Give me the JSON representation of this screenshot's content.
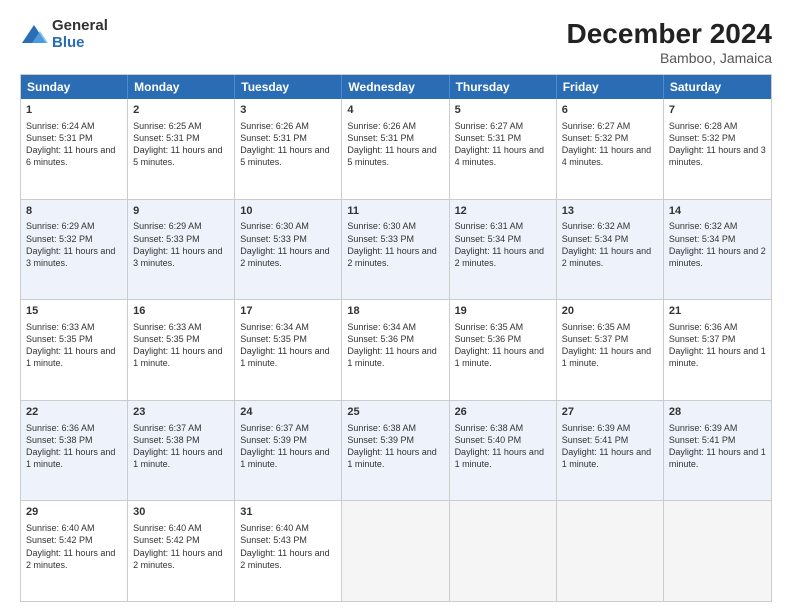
{
  "logo": {
    "general": "General",
    "blue": "Blue"
  },
  "title": {
    "month": "December 2024",
    "location": "Bamboo, Jamaica"
  },
  "header": {
    "days": [
      "Sunday",
      "Monday",
      "Tuesday",
      "Wednesday",
      "Thursday",
      "Friday",
      "Saturday"
    ]
  },
  "weeks": [
    [
      {
        "day": "1",
        "sunrise": "6:24 AM",
        "sunset": "5:31 PM",
        "daylight": "11 hours and 6 minutes."
      },
      {
        "day": "2",
        "sunrise": "6:25 AM",
        "sunset": "5:31 PM",
        "daylight": "11 hours and 5 minutes."
      },
      {
        "day": "3",
        "sunrise": "6:26 AM",
        "sunset": "5:31 PM",
        "daylight": "11 hours and 5 minutes."
      },
      {
        "day": "4",
        "sunrise": "6:26 AM",
        "sunset": "5:31 PM",
        "daylight": "11 hours and 5 minutes."
      },
      {
        "day": "5",
        "sunrise": "6:27 AM",
        "sunset": "5:31 PM",
        "daylight": "11 hours and 4 minutes."
      },
      {
        "day": "6",
        "sunrise": "6:27 AM",
        "sunset": "5:32 PM",
        "daylight": "11 hours and 4 minutes."
      },
      {
        "day": "7",
        "sunrise": "6:28 AM",
        "sunset": "5:32 PM",
        "daylight": "11 hours and 3 minutes."
      }
    ],
    [
      {
        "day": "8",
        "sunrise": "6:29 AM",
        "sunset": "5:32 PM",
        "daylight": "11 hours and 3 minutes."
      },
      {
        "day": "9",
        "sunrise": "6:29 AM",
        "sunset": "5:33 PM",
        "daylight": "11 hours and 3 minutes."
      },
      {
        "day": "10",
        "sunrise": "6:30 AM",
        "sunset": "5:33 PM",
        "daylight": "11 hours and 2 minutes."
      },
      {
        "day": "11",
        "sunrise": "6:30 AM",
        "sunset": "5:33 PM",
        "daylight": "11 hours and 2 minutes."
      },
      {
        "day": "12",
        "sunrise": "6:31 AM",
        "sunset": "5:34 PM",
        "daylight": "11 hours and 2 minutes."
      },
      {
        "day": "13",
        "sunrise": "6:32 AM",
        "sunset": "5:34 PM",
        "daylight": "11 hours and 2 minutes."
      },
      {
        "day": "14",
        "sunrise": "6:32 AM",
        "sunset": "5:34 PM",
        "daylight": "11 hours and 2 minutes."
      }
    ],
    [
      {
        "day": "15",
        "sunrise": "6:33 AM",
        "sunset": "5:35 PM",
        "daylight": "11 hours and 1 minute."
      },
      {
        "day": "16",
        "sunrise": "6:33 AM",
        "sunset": "5:35 PM",
        "daylight": "11 hours and 1 minute."
      },
      {
        "day": "17",
        "sunrise": "6:34 AM",
        "sunset": "5:35 PM",
        "daylight": "11 hours and 1 minute."
      },
      {
        "day": "18",
        "sunrise": "6:34 AM",
        "sunset": "5:36 PM",
        "daylight": "11 hours and 1 minute."
      },
      {
        "day": "19",
        "sunrise": "6:35 AM",
        "sunset": "5:36 PM",
        "daylight": "11 hours and 1 minute."
      },
      {
        "day": "20",
        "sunrise": "6:35 AM",
        "sunset": "5:37 PM",
        "daylight": "11 hours and 1 minute."
      },
      {
        "day": "21",
        "sunrise": "6:36 AM",
        "sunset": "5:37 PM",
        "daylight": "11 hours and 1 minute."
      }
    ],
    [
      {
        "day": "22",
        "sunrise": "6:36 AM",
        "sunset": "5:38 PM",
        "daylight": "11 hours and 1 minute."
      },
      {
        "day": "23",
        "sunrise": "6:37 AM",
        "sunset": "5:38 PM",
        "daylight": "11 hours and 1 minute."
      },
      {
        "day": "24",
        "sunrise": "6:37 AM",
        "sunset": "5:39 PM",
        "daylight": "11 hours and 1 minute."
      },
      {
        "day": "25",
        "sunrise": "6:38 AM",
        "sunset": "5:39 PM",
        "daylight": "11 hours and 1 minute."
      },
      {
        "day": "26",
        "sunrise": "6:38 AM",
        "sunset": "5:40 PM",
        "daylight": "11 hours and 1 minute."
      },
      {
        "day": "27",
        "sunrise": "6:39 AM",
        "sunset": "5:41 PM",
        "daylight": "11 hours and 1 minute."
      },
      {
        "day": "28",
        "sunrise": "6:39 AM",
        "sunset": "5:41 PM",
        "daylight": "11 hours and 1 minute."
      }
    ],
    [
      {
        "day": "29",
        "sunrise": "6:40 AM",
        "sunset": "5:42 PM",
        "daylight": "11 hours and 2 minutes."
      },
      {
        "day": "30",
        "sunrise": "6:40 AM",
        "sunset": "5:42 PM",
        "daylight": "11 hours and 2 minutes."
      },
      {
        "day": "31",
        "sunrise": "6:40 AM",
        "sunset": "5:43 PM",
        "daylight": "11 hours and 2 minutes."
      },
      null,
      null,
      null,
      null
    ]
  ],
  "labels": {
    "sunrise": "Sunrise: ",
    "sunset": "Sunset: ",
    "daylight": "Daylight: "
  }
}
